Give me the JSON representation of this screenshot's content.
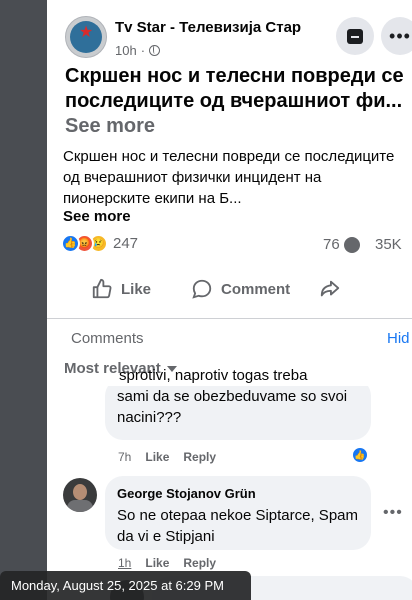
{
  "post": {
    "page_name": "Tv Star - Телевизија Стар",
    "time": "10h",
    "headline": "Скршен нос и телесни повреди се последиците од вчерашниот фи...",
    "headline_see_more": "See more",
    "body": "Скршен нос и телесни повреди се последиците од вчерашниот физички инцидент на пионерските екипи на Б...",
    "see_more": "See more",
    "reaction_count": "247",
    "comment_count": "76",
    "share_count": "35K"
  },
  "actions": {
    "like": "Like",
    "comment": "Comment"
  },
  "comments_section": {
    "label": "Comments",
    "hide": "Hid",
    "sort": "Most relevant"
  },
  "comments": [
    {
      "text_partial_top": "sprotivi, naprotiv togas treba",
      "text": "sami da se obezbeduvame so svoi nacini???",
      "time": "7h",
      "like": "Like",
      "reply": "Reply"
    },
    {
      "author": "George Stojanov Grün",
      "text": "So ne otepaa nekoe Siptarce, Spam da vi e Stipjani",
      "time": "1h",
      "like": "Like",
      "reply": "Reply"
    }
  ],
  "tooltip": "Monday, August 25, 2025 at 6:29 PM",
  "colors": {
    "accent": "#1877f2",
    "secondary_text": "#65676b",
    "bubble_bg": "#f0f2f5"
  }
}
